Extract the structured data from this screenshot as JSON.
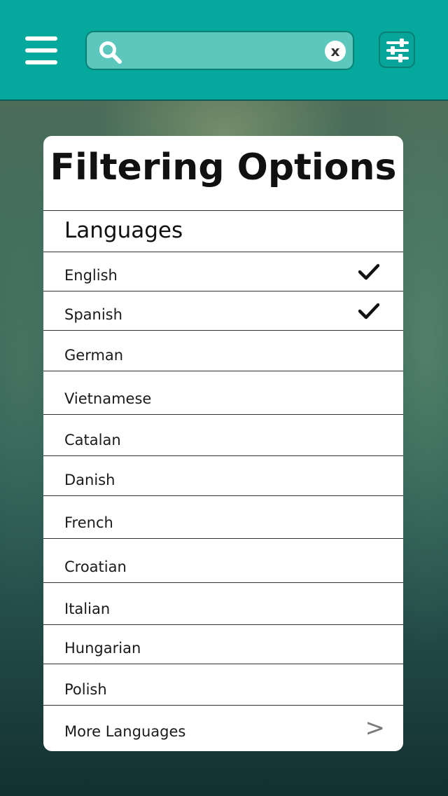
{
  "search": {
    "value": "",
    "placeholder": "",
    "clear_label": "x"
  },
  "icons": {
    "menu": "hamburger-menu-icon",
    "search": "search-icon",
    "clear": "clear-icon",
    "filter": "sliders-icon",
    "check": "checkmark-icon",
    "more": "chevron-right-icon"
  },
  "colors": {
    "topbar": "#05a89c",
    "search_field": "#5cc8bd",
    "card": "#ffffff",
    "text": "#1a1a1a",
    "chevron": "#7a7a7a"
  },
  "panel": {
    "title": "Filtering Options",
    "section_label": "Languages",
    "languages": [
      {
        "label": "English",
        "selected": true
      },
      {
        "label": "Spanish",
        "selected": true
      },
      {
        "label": "German",
        "selected": false
      },
      {
        "label": "Vietnamese",
        "selected": false
      },
      {
        "label": "Catalan",
        "selected": false
      },
      {
        "label": "Danish",
        "selected": false
      },
      {
        "label": "French",
        "selected": false
      },
      {
        "label": "Croatian",
        "selected": false
      },
      {
        "label": "Italian",
        "selected": false
      },
      {
        "label": "Hungarian",
        "selected": false
      },
      {
        "label": "Polish",
        "selected": false
      }
    ],
    "more_label": "More Languages",
    "more_chevron": ">"
  }
}
